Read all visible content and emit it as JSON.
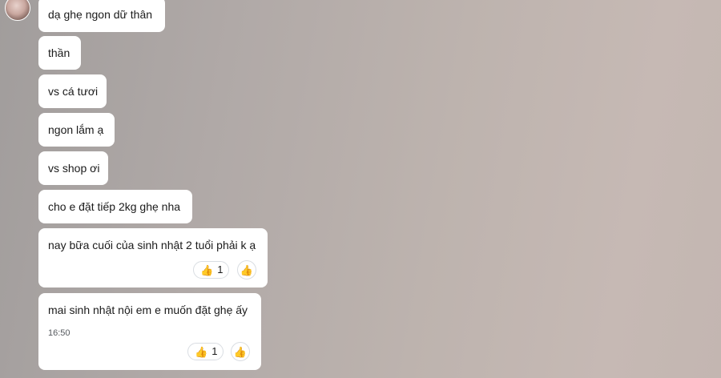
{
  "messages": [
    {
      "text": "dạ ghẹ ngon dữ thân"
    },
    {
      "text": "thần"
    },
    {
      "text": "vs cá tươi"
    },
    {
      "text": "ngon lắm ạ"
    },
    {
      "text": "vs shop ơi"
    },
    {
      "text": "cho e đặt tiếp 2kg ghẹ nha"
    },
    {
      "text": "nay bữa cuối của sinh nhật 2 tuổi phải k ạ",
      "reaction": {
        "icon": "thumbs-up-icon",
        "count": "1"
      }
    },
    {
      "text": "mai sinh nhật nội em e muốn đặt ghẹ ấy",
      "time": "16:50",
      "reaction": {
        "icon": "thumbs-up-icon",
        "count": "1"
      }
    }
  ],
  "icons": {
    "thumb": "👍"
  },
  "colors": {
    "bubble": "#ffffff",
    "text": "#1b1b1b",
    "time": "#55595e"
  }
}
